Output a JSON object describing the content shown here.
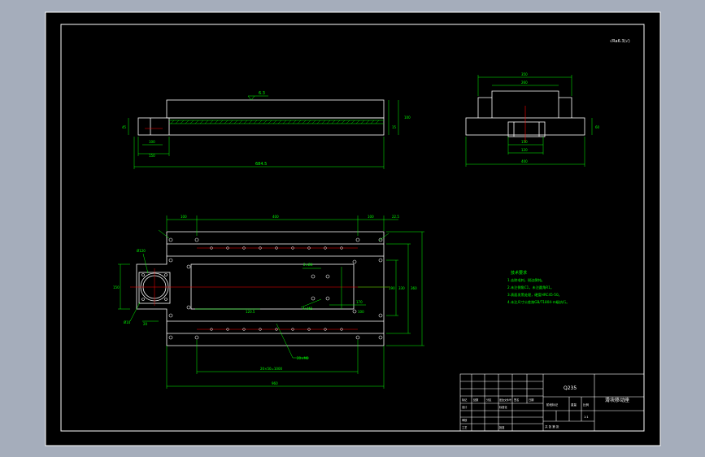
{
  "drawing": {
    "roughness_symbol": "√Ra6.3(√)",
    "colors": {
      "background_outer": "#a5adbb",
      "sheet": "#000000",
      "outline": "#ffffff",
      "dimension": "#00ff00",
      "center_line": "#ff0000",
      "notes": "#00ff00"
    }
  },
  "front_view": {
    "surface_label": "6.3",
    "dim_bottom": "684.5",
    "dim_left_small": "150",
    "dim_left_inner": "100",
    "dim_left_height": "45",
    "dim_right_height": "100",
    "dim_right_small": "15"
  },
  "side_view": {
    "dim_top_outer": "350",
    "dim_top_inner": "260",
    "dim_mid": "150",
    "dim_bottom": "400",
    "dim_bottom_inner": "120",
    "dim_right": "60"
  },
  "top_view": {
    "dim_top_1": "100",
    "dim_top_2": "400",
    "dim_top_3": "100",
    "dim_top_4": "22.5",
    "dim_left": "150",
    "dim_circle": "Ø120",
    "dim_left_2": "20",
    "dim_left_3": "Ø10",
    "label_hole_1": "2×Ø4",
    "label_hole_2": "4×M8",
    "label_mid": "120.5",
    "label_holes_row": "20×M6",
    "label_right_1": "190",
    "label_right_2": "360",
    "label_right_3": "330",
    "label_r1": "170",
    "label_r2": "100",
    "dim_bottom_1": "20×50=1000",
    "dim_bottom_2": "960"
  },
  "tech_notes": {
    "title": "技术要求",
    "items": [
      "1.去除毛刺，锐边倒钝。",
      "2.未注倒角C1，未注圆角R1。",
      "3.表面发黑处理，硬度HRC45-50。",
      "4.未注尺寸公差按GB/T1804-m级执行。"
    ]
  },
  "title_block": {
    "material": "Q235",
    "part_name": "滑块移动座",
    "scale_label": "比例",
    "scale_value": "1:1",
    "weight_label": "重量",
    "count_label": "数量",
    "design_label": "设计",
    "check_label": "审核",
    "process_label": "工艺",
    "standard_label": "标准化",
    "approve_label": "批准",
    "sheet_label": "共  张  第  张",
    "stage_label": "阶段标记",
    "sign_label": "签名",
    "date_label": "日期",
    "mark_label": "标记",
    "qty_label": "处数",
    "zone_label": "分区",
    "doc_label": "更改文件号"
  }
}
